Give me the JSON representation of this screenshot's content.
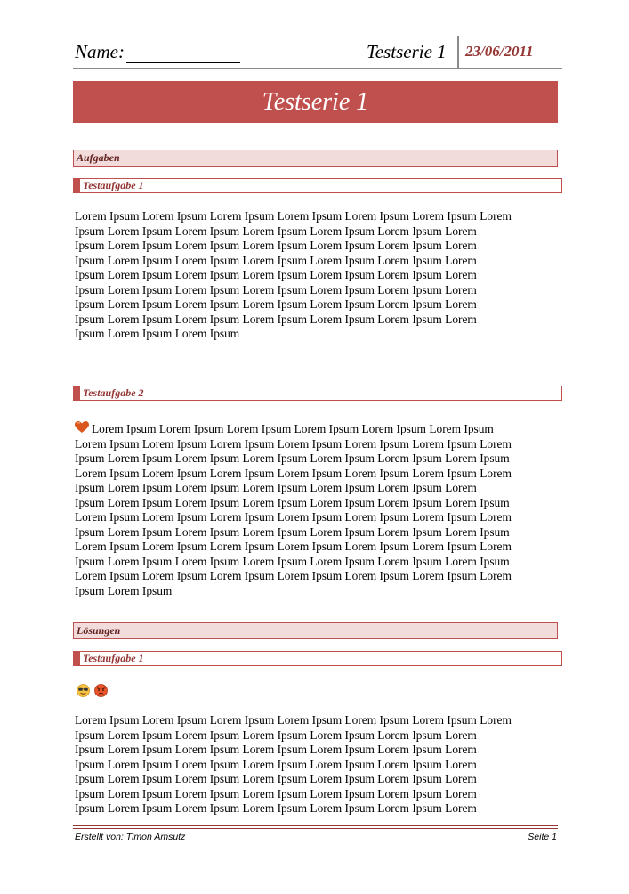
{
  "header": {
    "name_label": "Name:",
    "series": "Testserie 1",
    "date": "23/06/2011"
  },
  "title": "Testserie 1",
  "sections": {
    "tasks_title": "Aufgaben",
    "task1_title": "Testaufgabe 1",
    "task1_lines": [
      "Lorem Ipsum Lorem Ipsum Lorem Ipsum Lorem Ipsum Lorem Ipsum Lorem Ipsum Lorem",
      "Ipsum Lorem Ipsum Lorem Ipsum Lorem Ipsum Lorem Ipsum Lorem Ipsum Lorem",
      "Ipsum Lorem Ipsum Lorem Ipsum Lorem Ipsum Lorem Ipsum Lorem Ipsum Lorem",
      "Ipsum Lorem Ipsum Lorem Ipsum Lorem Ipsum Lorem Ipsum Lorem Ipsum Lorem",
      "Ipsum Lorem Ipsum Lorem Ipsum Lorem Ipsum Lorem Ipsum Lorem Ipsum Lorem",
      "Ipsum Lorem Ipsum Lorem Ipsum Lorem Ipsum Lorem Ipsum Lorem Ipsum Lorem",
      "Ipsum Lorem Ipsum Lorem Ipsum Lorem Ipsum Lorem Ipsum Lorem Ipsum Lorem",
      "Ipsum Lorem Ipsum Lorem Ipsum Lorem Ipsum Lorem Ipsum Lorem Ipsum Lorem",
      "Ipsum Lorem Ipsum Lorem Ipsum"
    ],
    "task2_title": "Testaufgabe 2",
    "task2_first_line": "Lorem Ipsum Lorem Ipsum Lorem Ipsum Lorem Ipsum  Lorem Ipsum Lorem Ipsum",
    "task2_lines": [
      "Lorem Ipsum Lorem Ipsum Lorem Ipsum Lorem Ipsum Lorem Ipsum Lorem Ipsum Lorem",
      "Ipsum Lorem Ipsum Lorem Ipsum Lorem Ipsum Lorem Ipsum Lorem Ipsum Lorem Ipsum",
      "Lorem Ipsum Lorem Ipsum Lorem Ipsum Lorem Ipsum Lorem Ipsum Lorem Ipsum Lorem",
      "Ipsum Lorem Ipsum Lorem Ipsum Lorem Ipsum Lorem Ipsum Lorem Ipsum Lorem",
      "Ipsum Lorem Ipsum Lorem Ipsum Lorem Ipsum Lorem Ipsum Lorem Ipsum Lorem Ipsum",
      "Lorem Ipsum Lorem Ipsum Lorem Ipsum Lorem Ipsum Lorem Ipsum Lorem Ipsum Lorem",
      "Ipsum Lorem Ipsum Lorem Ipsum Lorem Ipsum Lorem Ipsum Lorem Ipsum Lorem Ipsum",
      "Lorem Ipsum Lorem Ipsum Lorem Ipsum Lorem Ipsum Lorem Ipsum Lorem Ipsum Lorem",
      "Ipsum Lorem Ipsum Lorem Ipsum Lorem Ipsum Lorem Ipsum Lorem Ipsum Lorem Ipsum",
      "Lorem Ipsum Lorem Ipsum Lorem Ipsum Lorem Ipsum Lorem Ipsum Lorem Ipsum Lorem",
      "Ipsum Lorem Ipsum"
    ],
    "solutions_title": "Lösungen",
    "solution1_title": "Testaufgabe 1",
    "solution1_lines": [
      "Lorem Ipsum Lorem Ipsum Lorem Ipsum Lorem Ipsum Lorem Ipsum Lorem Ipsum Lorem",
      "Ipsum Lorem Ipsum Lorem Ipsum Lorem Ipsum Lorem Ipsum Lorem Ipsum Lorem",
      "Ipsum Lorem Ipsum Lorem Ipsum Lorem Ipsum Lorem Ipsum Lorem Ipsum Lorem",
      "Ipsum Lorem Ipsum Lorem Ipsum Lorem Ipsum Lorem Ipsum Lorem Ipsum Lorem",
      "Ipsum Lorem Ipsum Lorem Ipsum Lorem Ipsum Lorem Ipsum Lorem Ipsum Lorem",
      "Ipsum Lorem Ipsum Lorem Ipsum Lorem Ipsum Lorem Ipsum Lorem Ipsum Lorem",
      "Ipsum Lorem Ipsum Lorem Ipsum Lorem Ipsum Lorem Ipsum Lorem Ipsum Lorem"
    ]
  },
  "icons": {
    "heart": "heart-icon",
    "emoji1": "cool-face-icon",
    "emoji2": "angry-face-icon"
  },
  "footer": {
    "author": "Erstellt von: Timon Amsutz",
    "page": "Seite 1"
  },
  "colors": {
    "accent": "#c0504d",
    "section_fill": "#f2dbdb",
    "date": "#953735"
  }
}
